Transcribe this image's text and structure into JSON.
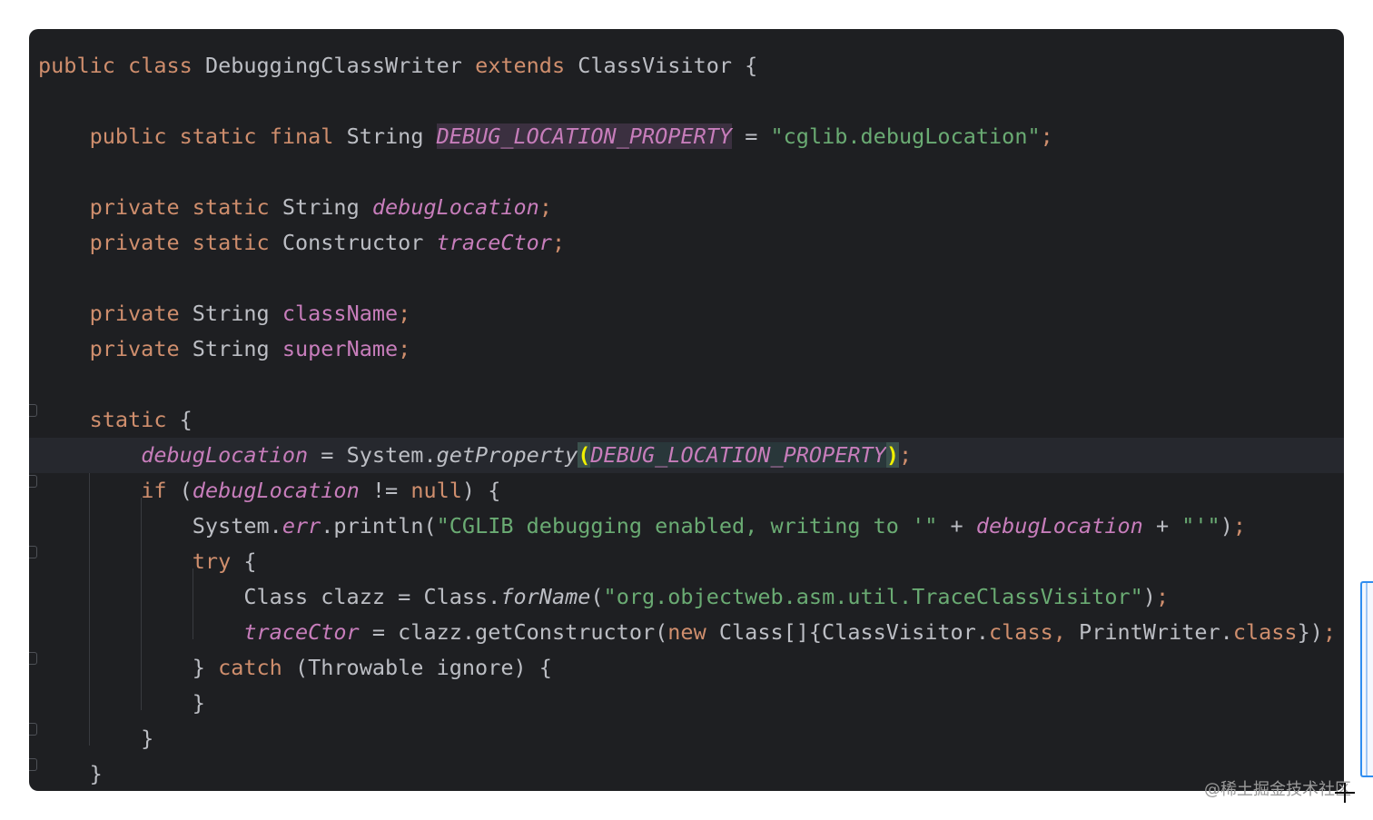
{
  "code_editor": {
    "lines": [
      [
        [
          "kw",
          "public "
        ],
        [
          "kw",
          "class "
        ],
        [
          "plain",
          "DebuggingClassWriter "
        ],
        [
          "kw",
          "extends "
        ],
        [
          "plain",
          "ClassVisitor {"
        ]
      ],
      [],
      [
        [
          "plain",
          "    "
        ],
        [
          "kw",
          "public "
        ],
        [
          "kw",
          "static "
        ],
        [
          "kw",
          "final "
        ],
        [
          "plain",
          "String "
        ],
        [
          "sfld hl-usage",
          "DEBUG_LOCATION_PROPERTY"
        ],
        [
          "plain",
          " = "
        ],
        [
          "str",
          "\"cglib.debugLocation\""
        ],
        [
          "kw",
          ";"
        ]
      ],
      [],
      [
        [
          "plain",
          "    "
        ],
        [
          "kw",
          "private "
        ],
        [
          "kw",
          "static "
        ],
        [
          "plain",
          "String "
        ],
        [
          "sfld",
          "debugLocation"
        ],
        [
          "kw",
          ";"
        ]
      ],
      [
        [
          "plain",
          "    "
        ],
        [
          "kw",
          "private "
        ],
        [
          "kw",
          "static "
        ],
        [
          "plain",
          "Constructor "
        ],
        [
          "sfld",
          "traceCtor"
        ],
        [
          "kw",
          ";"
        ]
      ],
      [],
      [
        [
          "plain",
          "    "
        ],
        [
          "kw",
          "private "
        ],
        [
          "plain",
          "String "
        ],
        [
          "fld",
          "className"
        ],
        [
          "kw",
          ";"
        ]
      ],
      [
        [
          "plain",
          "    "
        ],
        [
          "kw",
          "private "
        ],
        [
          "plain",
          "String "
        ],
        [
          "fld",
          "superName"
        ],
        [
          "kw",
          ";"
        ]
      ],
      [],
      [
        [
          "plain",
          "    "
        ],
        [
          "kw",
          "static "
        ],
        [
          "plain",
          "{"
        ]
      ],
      [
        [
          "plain",
          "        "
        ],
        [
          "sfld",
          "debugLocation"
        ],
        [
          "plain",
          " = System."
        ],
        [
          "sm",
          "getProperty"
        ],
        [
          "hl-paren",
          "("
        ],
        [
          "sfld hl-arg",
          "DEBUG_LOCATION_PROPERTY"
        ],
        [
          "hl-paren",
          ")"
        ],
        [
          "kw",
          ";"
        ]
      ],
      [
        [
          "plain",
          "        "
        ],
        [
          "kw",
          "if "
        ],
        [
          "plain",
          "("
        ],
        [
          "sfld",
          "debugLocation"
        ],
        [
          "plain",
          " != "
        ],
        [
          "kw",
          "null"
        ],
        [
          "plain",
          ") {"
        ]
      ],
      [
        [
          "plain",
          "            System."
        ],
        [
          "sfld",
          "err"
        ],
        [
          "plain",
          ".println("
        ],
        [
          "str",
          "\"CGLIB debugging enabled, writing to '\""
        ],
        [
          "plain",
          " + "
        ],
        [
          "sfld",
          "debugLocation"
        ],
        [
          "plain",
          " + "
        ],
        [
          "str",
          "\"'\""
        ],
        [
          "plain",
          ")"
        ],
        [
          "kw",
          ";"
        ]
      ],
      [
        [
          "plain",
          "            "
        ],
        [
          "kw",
          "try "
        ],
        [
          "plain",
          "{"
        ]
      ],
      [
        [
          "plain",
          "                Class clazz = Class."
        ],
        [
          "sm",
          "forName"
        ],
        [
          "plain",
          "("
        ],
        [
          "str",
          "\"org.objectweb.asm.util.TraceClassVisitor\""
        ],
        [
          "plain",
          ")"
        ],
        [
          "kw",
          ";"
        ]
      ],
      [
        [
          "plain",
          "                "
        ],
        [
          "sfld",
          "traceCtor"
        ],
        [
          "plain",
          " = clazz.getConstructor("
        ],
        [
          "kw",
          "new "
        ],
        [
          "plain",
          "Class[]{ClassVisitor."
        ],
        [
          "kw",
          "class"
        ],
        [
          "kw",
          ", "
        ],
        [
          "plain",
          "PrintWriter."
        ],
        [
          "kw",
          "class"
        ],
        [
          "plain",
          "})"
        ],
        [
          "kw",
          ";"
        ]
      ],
      [
        [
          "plain",
          "            } "
        ],
        [
          "kw",
          "catch "
        ],
        [
          "plain",
          "(Throwable ignore) {"
        ]
      ],
      [
        [
          "plain",
          "            }"
        ]
      ],
      [
        [
          "plain",
          "        }"
        ]
      ],
      [
        [
          "plain",
          "    }"
        ]
      ]
    ],
    "current_line": 11
  },
  "watermark": "@稀土掘金技术社区"
}
